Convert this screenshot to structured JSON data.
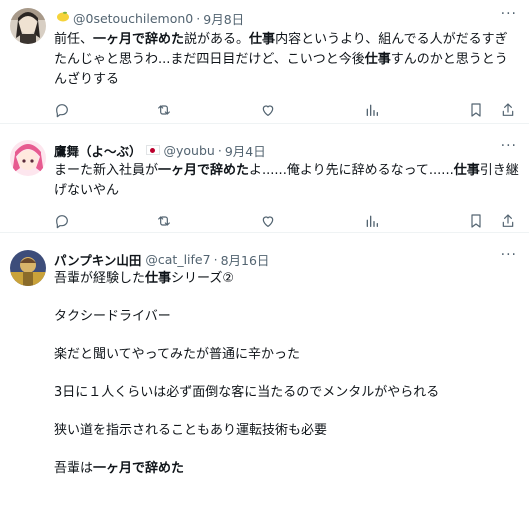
{
  "tweets": [
    {
      "display_name": "",
      "handle": "@0setouchilemon0",
      "dot": "·",
      "date": "9月8日",
      "badge_icon": "lemon-icon",
      "body": [
        {
          "text": "前任、"
        },
        {
          "text": "一ヶ月で辞めた",
          "bold": true
        },
        {
          "text": "説がある。"
        },
        {
          "text": "仕事",
          "bold": true
        },
        {
          "text": "内容というより、組んでる人がだるすぎたんじゃと思うわ...まだ四日目だけど、こいつと今後"
        },
        {
          "text": "仕事",
          "bold": true
        },
        {
          "text": "すんのかと思うとうんざりする"
        }
      ]
    },
    {
      "display_name": "鷹舞（よ〜ぶ）",
      "handle": "@youbu",
      "dot": "·",
      "date": "9月4日",
      "badge_icon": "japan-flag-icon",
      "body": [
        {
          "text": "まーた新入社員が"
        },
        {
          "text": "一ヶ月で辞めた",
          "bold": true
        },
        {
          "text": "よ......俺より先に辞めるなって......"
        },
        {
          "text": "仕事",
          "bold": true
        },
        {
          "text": "引き継げないやん"
        }
      ]
    },
    {
      "display_name": "パンプキン山田",
      "handle": "@cat_life7",
      "dot": "·",
      "date": "8月16日",
      "badge_icon": "",
      "paragraphs": [
        [
          {
            "text": "吾輩が経験した"
          },
          {
            "text": "仕事",
            "bold": true
          },
          {
            "text": "シリーズ②"
          }
        ],
        [
          {
            "text": "タクシードライバー"
          }
        ],
        [
          {
            "text": "楽だと聞いてやってみたが普通に辛かった"
          }
        ],
        [
          {
            "text": "3日に１人くらいは必ず面倒な客に当たるのでメンタルがやられる"
          }
        ],
        [
          {
            "text": "狭い道を指示されることもあり運転技術も必要"
          }
        ],
        [
          {
            "text": "吾輩は"
          },
          {
            "text": "一ヶ月で辞めた",
            "bold": true
          }
        ]
      ]
    }
  ],
  "action_icons": [
    "reply-icon",
    "repost-icon",
    "like-icon",
    "views-icon",
    "bookmark-icon",
    "share-icon"
  ],
  "more_label": "···",
  "colors": {
    "text": "#0f1419",
    "muted": "#536471",
    "border": "#eff3f4"
  }
}
